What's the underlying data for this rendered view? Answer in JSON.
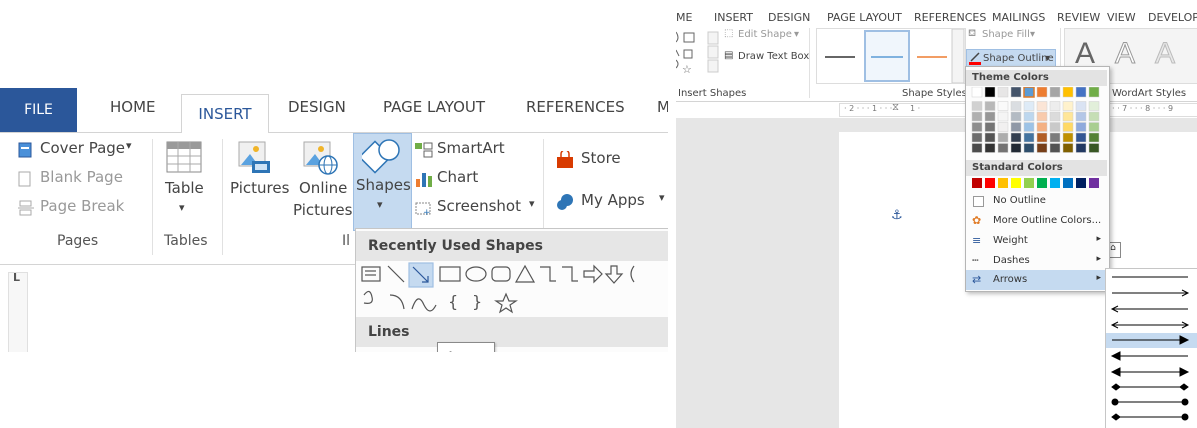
{
  "left": {
    "tabs": {
      "file": "FILE",
      "home": "HOME",
      "insert": "INSERT",
      "design": "DESIGN",
      "page_layout": "PAGE LAYOUT",
      "references": "REFERENCES",
      "more": "M"
    },
    "pages_group": {
      "cover_page": "Cover Page",
      "cover_caret": "▾",
      "blank_page": "Blank Page",
      "page_break": "Page Break",
      "label": "Pages"
    },
    "tables_group": {
      "table": "Table",
      "table_caret": "▾",
      "label": "Tables"
    },
    "illustrations": {
      "pictures": "Pictures",
      "online_pictures_1": "Online",
      "online_pictures_2": "Pictures",
      "shapes": "Shapes",
      "shapes_caret": "▾",
      "smartart": "SmartArt",
      "chart": "Chart",
      "screenshot": "Screenshot",
      "screenshot_caret": "▾",
      "label": "Il"
    },
    "apps": {
      "store": "Store",
      "my_apps": "My Apps",
      "my_apps_caret": "▾"
    },
    "dropdown": {
      "recent_header": "Recently Used Shapes",
      "lines_header": "Lines",
      "tooltip": "Arrow"
    },
    "ruler_mark": "L"
  },
  "right": {
    "tabs": {
      "home": "ME",
      "insert": "INSERT",
      "design": "DESIGN",
      "page_layout": "PAGE LAYOUT",
      "references": "REFERENCES",
      "mailings": "MAILINGS",
      "review": "REVIEW",
      "view": "VIEW",
      "developer": "DEVELOP"
    },
    "insert_shapes": {
      "edit_shape": "Edit Shape",
      "edit_caret": "▾",
      "draw_text_box": "Draw Text Box",
      "label": "Insert Shapes"
    },
    "shape_styles": {
      "label": "Shape Styles",
      "shape_fill": "Shape Fill",
      "fill_caret": "▾",
      "shape_outline": "Shape Outline",
      "outline_caret": "▾"
    },
    "wordart": {
      "label": "WordArt Styles",
      "letter": "A"
    },
    "ruler": {
      "left": "· 2 · · · 1 · · ·",
      "mid": "1 ·",
      "right": "· · 7 · · · 8 · · · 9"
    },
    "menu": {
      "theme_header": "Theme Colors",
      "standard_header": "Standard Colors",
      "no_outline": "No Outline",
      "more_colors": "More Outline Colors...",
      "weight": "Weight",
      "dashes": "Dashes",
      "arrows": "Arrows",
      "submenu_caret": "▸"
    },
    "anchor": "⚓",
    "colors": {
      "theme_top": [
        "#ffffff",
        "#000000",
        "#e7e6e6",
        "#44546a",
        "#5b9bd5",
        "#ed7d31",
        "#a5a5a5",
        "#ffc000",
        "#4472c4",
        "#70ad47"
      ],
      "standard": [
        "#c00000",
        "#ff0000",
        "#ffc000",
        "#ffff00",
        "#92d050",
        "#00b050",
        "#00b0f0",
        "#0070c0",
        "#002060",
        "#7030a0"
      ],
      "highlight": "#c5daf0",
      "file_tab": "#2b579a"
    }
  }
}
